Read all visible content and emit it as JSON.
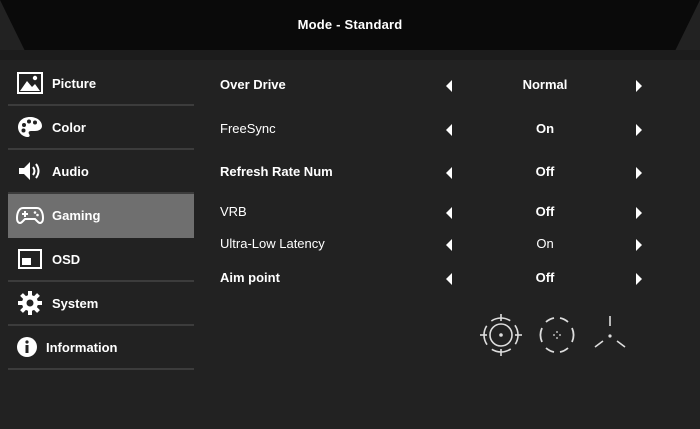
{
  "header": {
    "title": "Mode - Standard"
  },
  "sidebar": {
    "items": [
      {
        "label": "Picture",
        "icon": "picture-icon",
        "active": false
      },
      {
        "label": "Color",
        "icon": "palette-icon",
        "active": false
      },
      {
        "label": "Audio",
        "icon": "speaker-icon",
        "active": false
      },
      {
        "label": "Gaming",
        "icon": "gamepad-icon",
        "active": true
      },
      {
        "label": "OSD",
        "icon": "osd-window-icon",
        "active": false
      },
      {
        "label": "System",
        "icon": "gear-icon",
        "active": false
      },
      {
        "label": "Information",
        "icon": "info-icon",
        "active": false
      }
    ]
  },
  "settings": {
    "rows": [
      {
        "label": "Over  Drive",
        "value": "Normal"
      },
      {
        "label": "FreeSync",
        "value": "On"
      },
      {
        "label": "Refresh Rate Num",
        "value": "Off"
      },
      {
        "label": "VRB",
        "value": "Off"
      },
      {
        "label": "Ultra-Low Latency",
        "value": "On"
      },
      {
        "label": "Aim point",
        "value": "Off"
      }
    ]
  },
  "aim_point_options": [
    "crosshair-circle-icon",
    "crosshair-bracket-icon",
    "crosshair-tri-icon"
  ],
  "colors": {
    "background": "#222222",
    "header": "#0a0a0a",
    "active_item": "#6f6f6f",
    "divider": "#3c3c3c",
    "text": "#ffffff"
  }
}
